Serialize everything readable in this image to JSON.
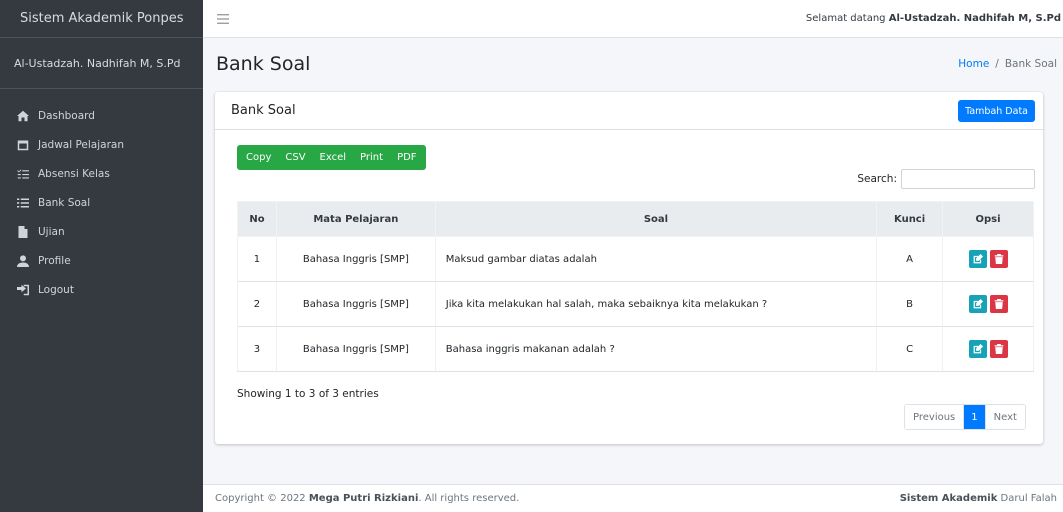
{
  "sidebar": {
    "brand": "Sistem Akademik Ponpes",
    "user": "Al-Ustadzah. Nadhifah M, S.Pd",
    "items": [
      {
        "label": "Dashboard",
        "icon": "home-icon"
      },
      {
        "label": "Jadwal Pelajaran",
        "icon": "calendar-icon"
      },
      {
        "label": "Absensi Kelas",
        "icon": "checklist-icon"
      },
      {
        "label": "Bank Soal",
        "icon": "list-icon"
      },
      {
        "label": "Ujian",
        "icon": "file-icon"
      },
      {
        "label": "Profile",
        "icon": "user-icon"
      },
      {
        "label": "Logout",
        "icon": "logout-icon"
      }
    ]
  },
  "topbar": {
    "welcome_prefix": "Selamat datang",
    "welcome_name": "Al-Ustadzah. Nadhifah M, S.Pd"
  },
  "header": {
    "title": "Bank Soal",
    "breadcrumb_home": "Home",
    "breadcrumb_sep": "/",
    "breadcrumb_current": "Bank Soal"
  },
  "card": {
    "title": "Bank Soal",
    "add_label": "Tambah Data",
    "export_buttons": [
      "Copy",
      "CSV",
      "Excel",
      "Print",
      "PDF"
    ],
    "search_label": "Search:",
    "search_value": "",
    "columns": [
      "No",
      "Mata Pelajaran",
      "Soal",
      "Kunci",
      "Opsi"
    ],
    "rows": [
      {
        "no": "1",
        "mapel": "Bahasa Inggris [SMP]",
        "soal": "Maksud gambar diatas adalah",
        "kunci": "A"
      },
      {
        "no": "2",
        "mapel": "Bahasa Inggris [SMP]",
        "soal": "Jika kita melakukan hal salah, maka sebaiknya kita melakukan ?",
        "kunci": "B"
      },
      {
        "no": "3",
        "mapel": "Bahasa Inggris [SMP]",
        "soal": "Bahasa inggris makanan adalah ?",
        "kunci": "C"
      }
    ],
    "info": "Showing 1 to 3 of 3 entries",
    "pagination": {
      "previous": "Previous",
      "current": "1",
      "next": "Next"
    }
  },
  "footer": {
    "copyright_prefix": "Copyright © 2022",
    "author": "Mega Putri Rizkiani",
    "rights": ". All rights reserved.",
    "app_bold": "Sistem Akademik",
    "app_rest": "Darul Falah"
  },
  "colors": {
    "sidebar_bg": "#343a40",
    "primary": "#007bff",
    "success": "#28a745",
    "info": "#17a2b8",
    "danger": "#dc3545"
  }
}
